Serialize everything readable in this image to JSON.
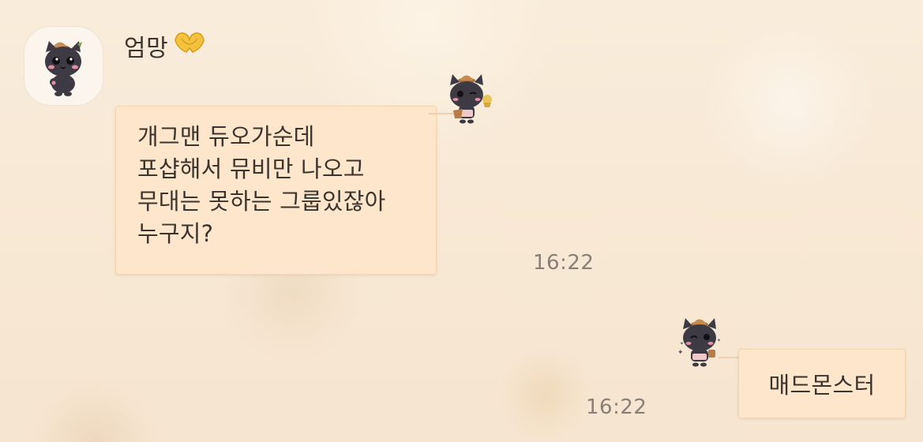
{
  "chat": {
    "sender": {
      "name": "엄망",
      "avatar_icon": "black-cat-character-avatar",
      "name_emoji": "heart-hands-emoji"
    },
    "messages": [
      {
        "direction": "incoming",
        "lines": [
          "개그맨 듀오가순데",
          "포샵해서 뮤비만 나오고",
          "무대는 못하는 그룹있잖아",
          "누구지?"
        ],
        "time": "16:22",
        "decoration_icon": "black-cat-tea-sticker"
      },
      {
        "direction": "outgoing",
        "text": "매드몬스터",
        "time": "16:22",
        "decoration_icon": "black-cat-sparkle-sticker"
      }
    ]
  },
  "colors": {
    "background": "#f8ead7",
    "bubble": "#fde6cb",
    "text": "#3d332d",
    "time": "#8a7f78"
  }
}
